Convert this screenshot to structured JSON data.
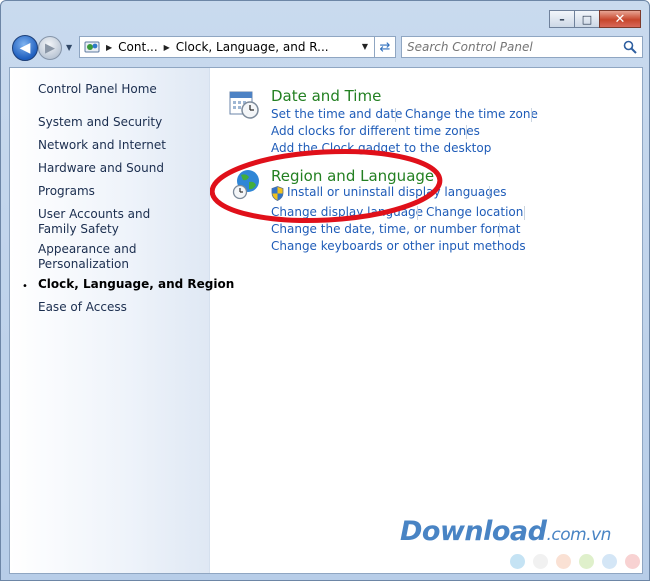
{
  "window": {
    "minimize_glyph": "–",
    "maximize_glyph": "□",
    "close_glyph": "✕"
  },
  "navbar": {
    "back_glyph": "◀",
    "forward_glyph": "▶",
    "recent_glyph": "▼",
    "breadcrumbs": [
      "Cont...",
      "Clock, Language, and R..."
    ],
    "breadcrumb_sep": "▶",
    "dropdown_glyph": "▼",
    "refresh_glyph": "⇄",
    "search_placeholder": "Search Control Panel"
  },
  "sidebar": {
    "home": "Control Panel Home",
    "items": [
      "System and Security",
      "Network and Internet",
      "Hardware and Sound",
      "Programs",
      "User Accounts and Family Safety",
      "Appearance and Personalization",
      "Clock, Language, and Region",
      "Ease of Access"
    ],
    "current_index": 6,
    "bullet": "•"
  },
  "categories": [
    {
      "title": "Date and Time",
      "icon": "calendar-clock-icon",
      "links": [
        "Set the time and date",
        "Change the time zone",
        "Add clocks for different time zones",
        "Add the Clock gadget to the desktop"
      ]
    },
    {
      "title": "Region and Language",
      "icon": "globe-clock-icon",
      "links": [
        "Install or uninstall display languages",
        "Change display language",
        "Change location",
        "Change the date, time, or number format",
        "Change keyboards or other input methods"
      ],
      "admin_shield_on_first": true
    }
  ],
  "annotation": {
    "color": "#e0101a"
  },
  "watermark": {
    "text": "Download",
    "suffix": ".com.vn",
    "dot_colors": [
      "#9fd0ec",
      "#e7e7e7",
      "#f6cdb7",
      "#c9e6a8",
      "#b7d6f0",
      "#f3b4b4"
    ]
  },
  "colors": {
    "category_title": "#238022",
    "link": "#1f5cb8"
  }
}
